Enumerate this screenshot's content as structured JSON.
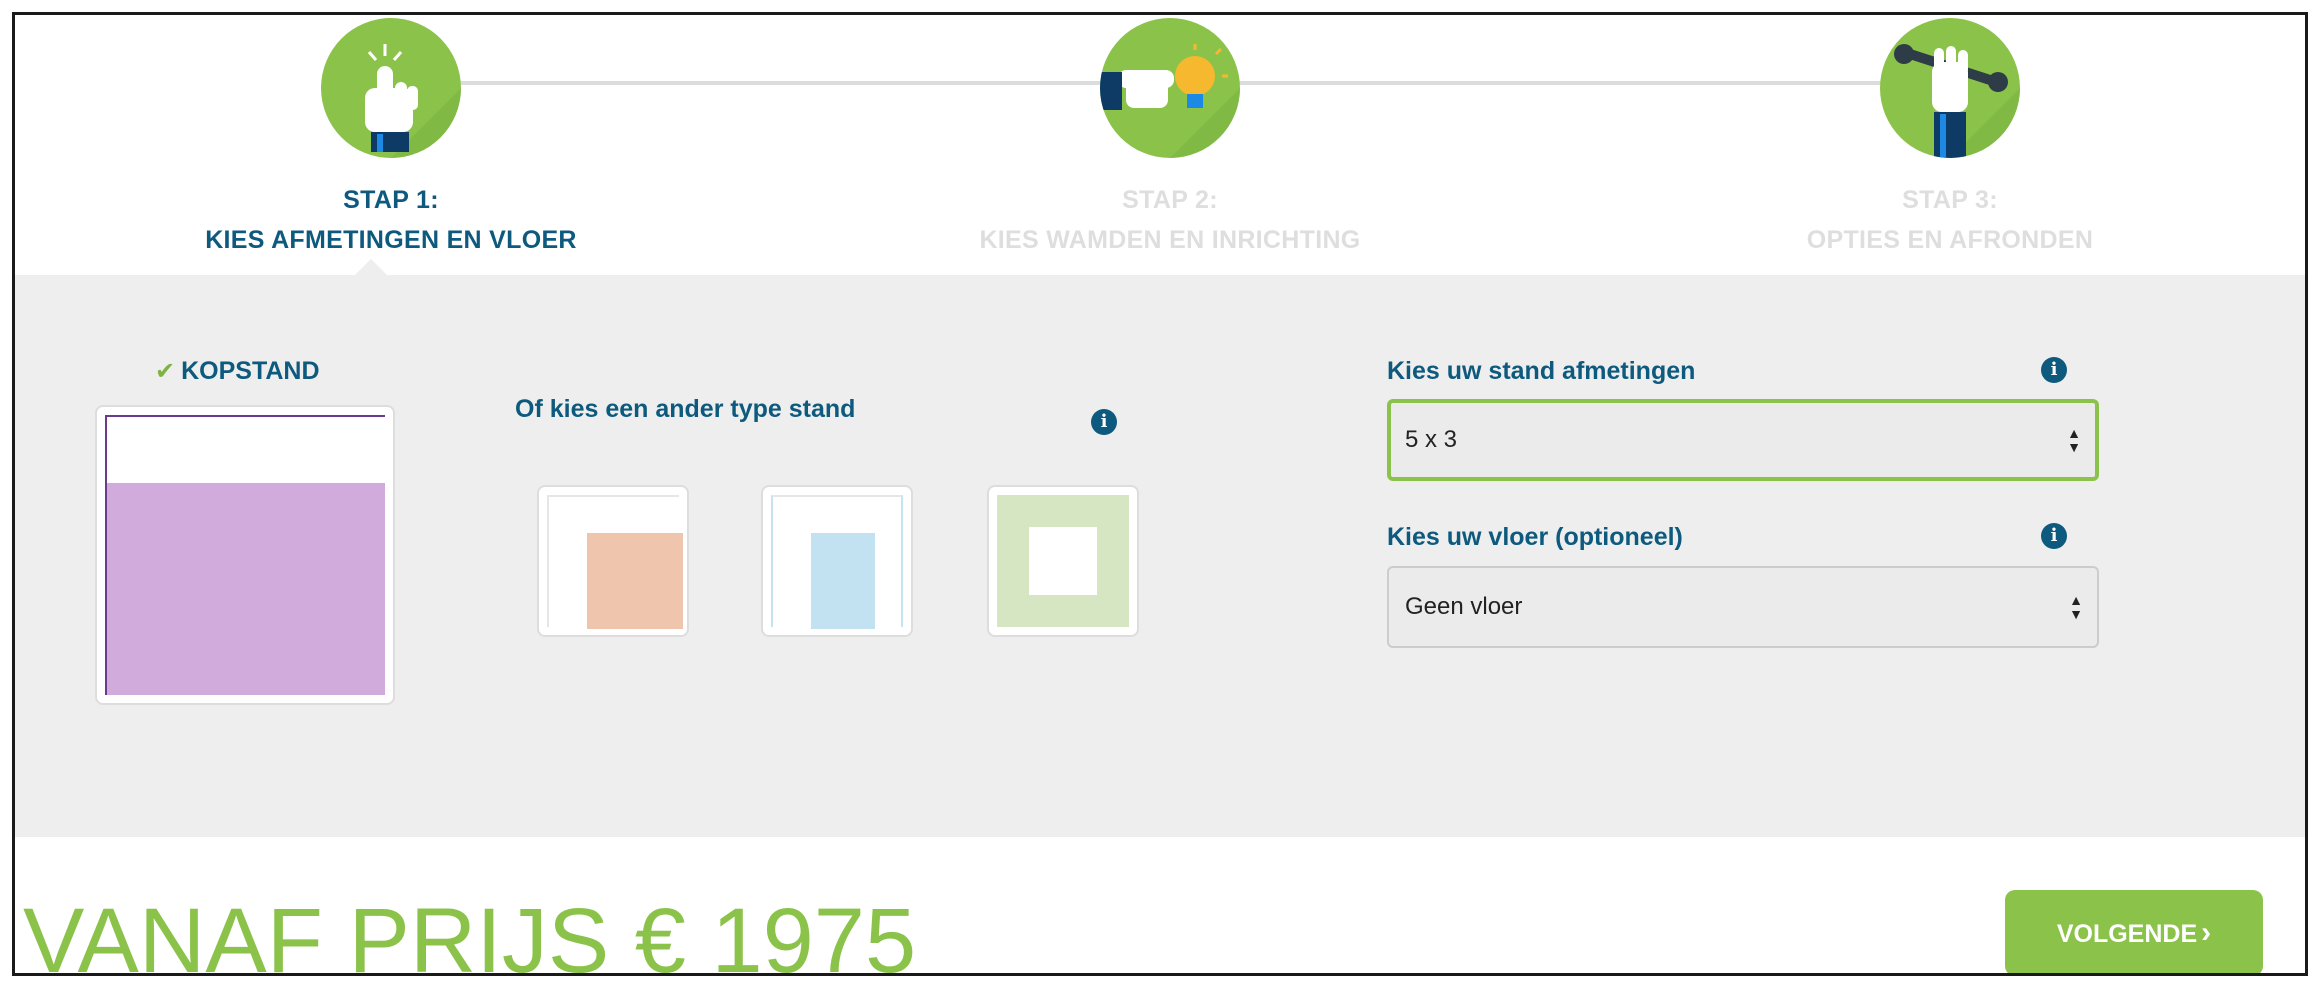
{
  "steps": [
    {
      "number": "STAP 1:",
      "name": "KIES AFMETINGEN EN VLOER",
      "state": "active",
      "icon": "pointing-hand-icon"
    },
    {
      "number": "STAP 2:",
      "name": "KIES WAMDEN EN INRICHTING",
      "state": "inactive",
      "icon": "hand-lightbulb-icon"
    },
    {
      "number": "STAP 3:",
      "name": "OPTIES EN AFRONDEN",
      "state": "inactive",
      "icon": "hand-wrench-icon"
    }
  ],
  "stand": {
    "selected_label": "KOPSTAND",
    "other_types_label": "Of kies een ander type stand",
    "types": [
      "corner-stand",
      "side-stand",
      "island-stand"
    ]
  },
  "dimensions": {
    "label": "Kies uw stand afmetingen",
    "value": "5 x 3"
  },
  "floor": {
    "label": "Kies uw vloer (optioneel)",
    "value": "Geen vloer"
  },
  "footer": {
    "price_text": "VANAF PRIJS € 1975",
    "next_label": "VOLGENDE"
  },
  "colors": {
    "brand_green": "#8bc34a",
    "heading_blue": "#0d5a7e",
    "panel_grey": "#eeeeee",
    "kopstand_purple": "#d1abdc"
  }
}
